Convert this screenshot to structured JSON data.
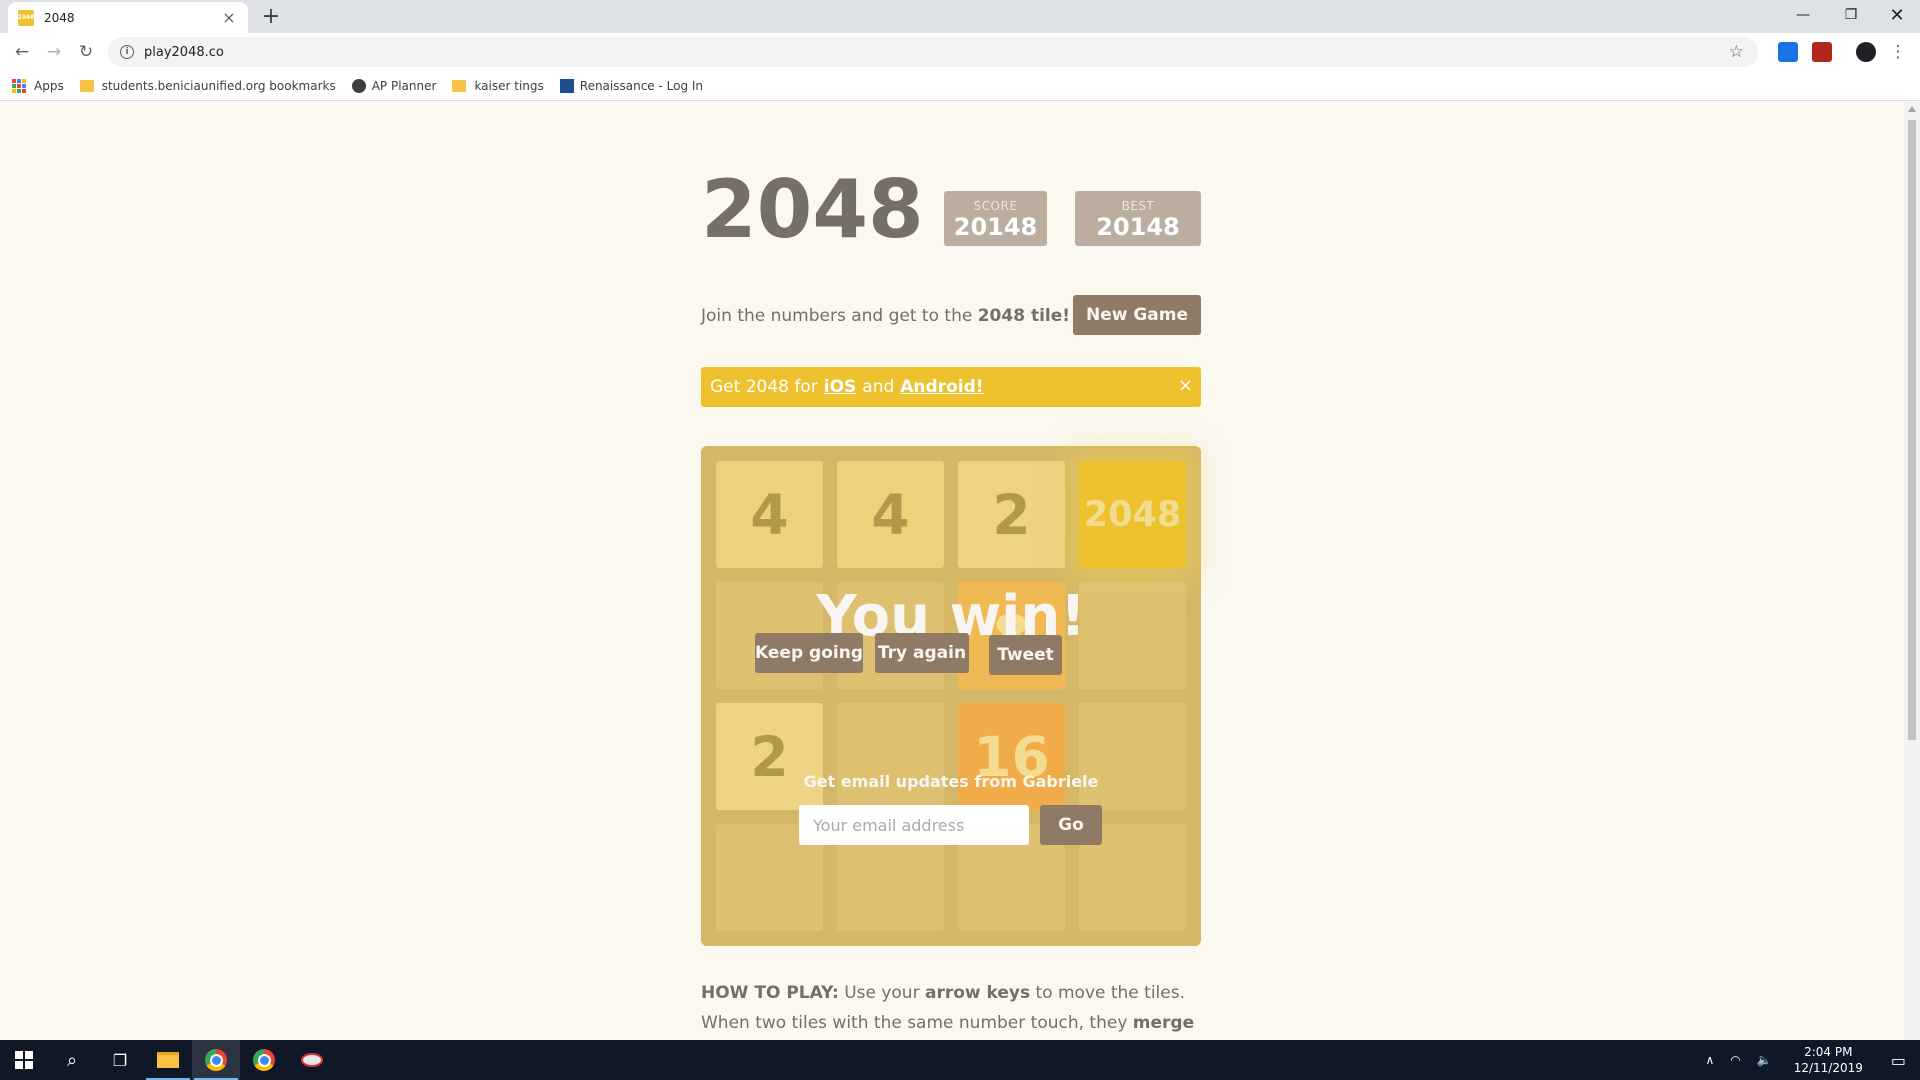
{
  "browser": {
    "tab_title": "2048",
    "favicon_text": "2048",
    "url": "play2048.co",
    "bookmarks": [
      {
        "label": "Apps",
        "icon": "apps-icon"
      },
      {
        "label": "students.beniciaunified.org bookmarks",
        "icon": "folder-icon"
      },
      {
        "label": "AP Planner",
        "icon": "globe-icon"
      },
      {
        "label": "kaiser tings",
        "icon": "folder-icon"
      },
      {
        "label": "Renaissance - Log In",
        "icon": "renaissance-icon"
      }
    ]
  },
  "game": {
    "title": "2048",
    "score_label": "SCORE",
    "score": "20148",
    "best_label": "BEST",
    "best": "20148",
    "intro_prefix": "Join the numbers and get to the",
    "intro_bold": "2048 tile!",
    "new_game_label": "New Game",
    "banner": {
      "prefix": "Get 2048 for",
      "ios": "iOS",
      "and": "and",
      "android": "Android!",
      "close": "×"
    },
    "board": [
      [
        "4",
        "4",
        "2",
        "2048"
      ],
      [
        "",
        "",
        "8",
        ""
      ],
      [
        "2",
        "",
        "16",
        ""
      ],
      [
        "",
        "",
        "",
        ""
      ]
    ],
    "win_message": "You win!",
    "keep_going_label": "Keep going",
    "try_again_label": "Try again",
    "tweet_label": "Tweet",
    "email_label": "Get email updates from Gabriele",
    "email_placeholder": "Your email address",
    "go_label": "Go",
    "howto_label": "HOW TO PLAY:",
    "howto_1": "Use your",
    "howto_keys": "arrow keys",
    "howto_2": "to move the tiles. When two tiles with the same number touch, they",
    "howto_merge": "merge into one!"
  },
  "taskbar": {
    "time": "2:04 PM",
    "date": "12/11/2019"
  },
  "colors": {
    "background": "#faf8ef",
    "board": "#bbada0",
    "accent": "#edc22e",
    "button": "#8f7a66"
  }
}
